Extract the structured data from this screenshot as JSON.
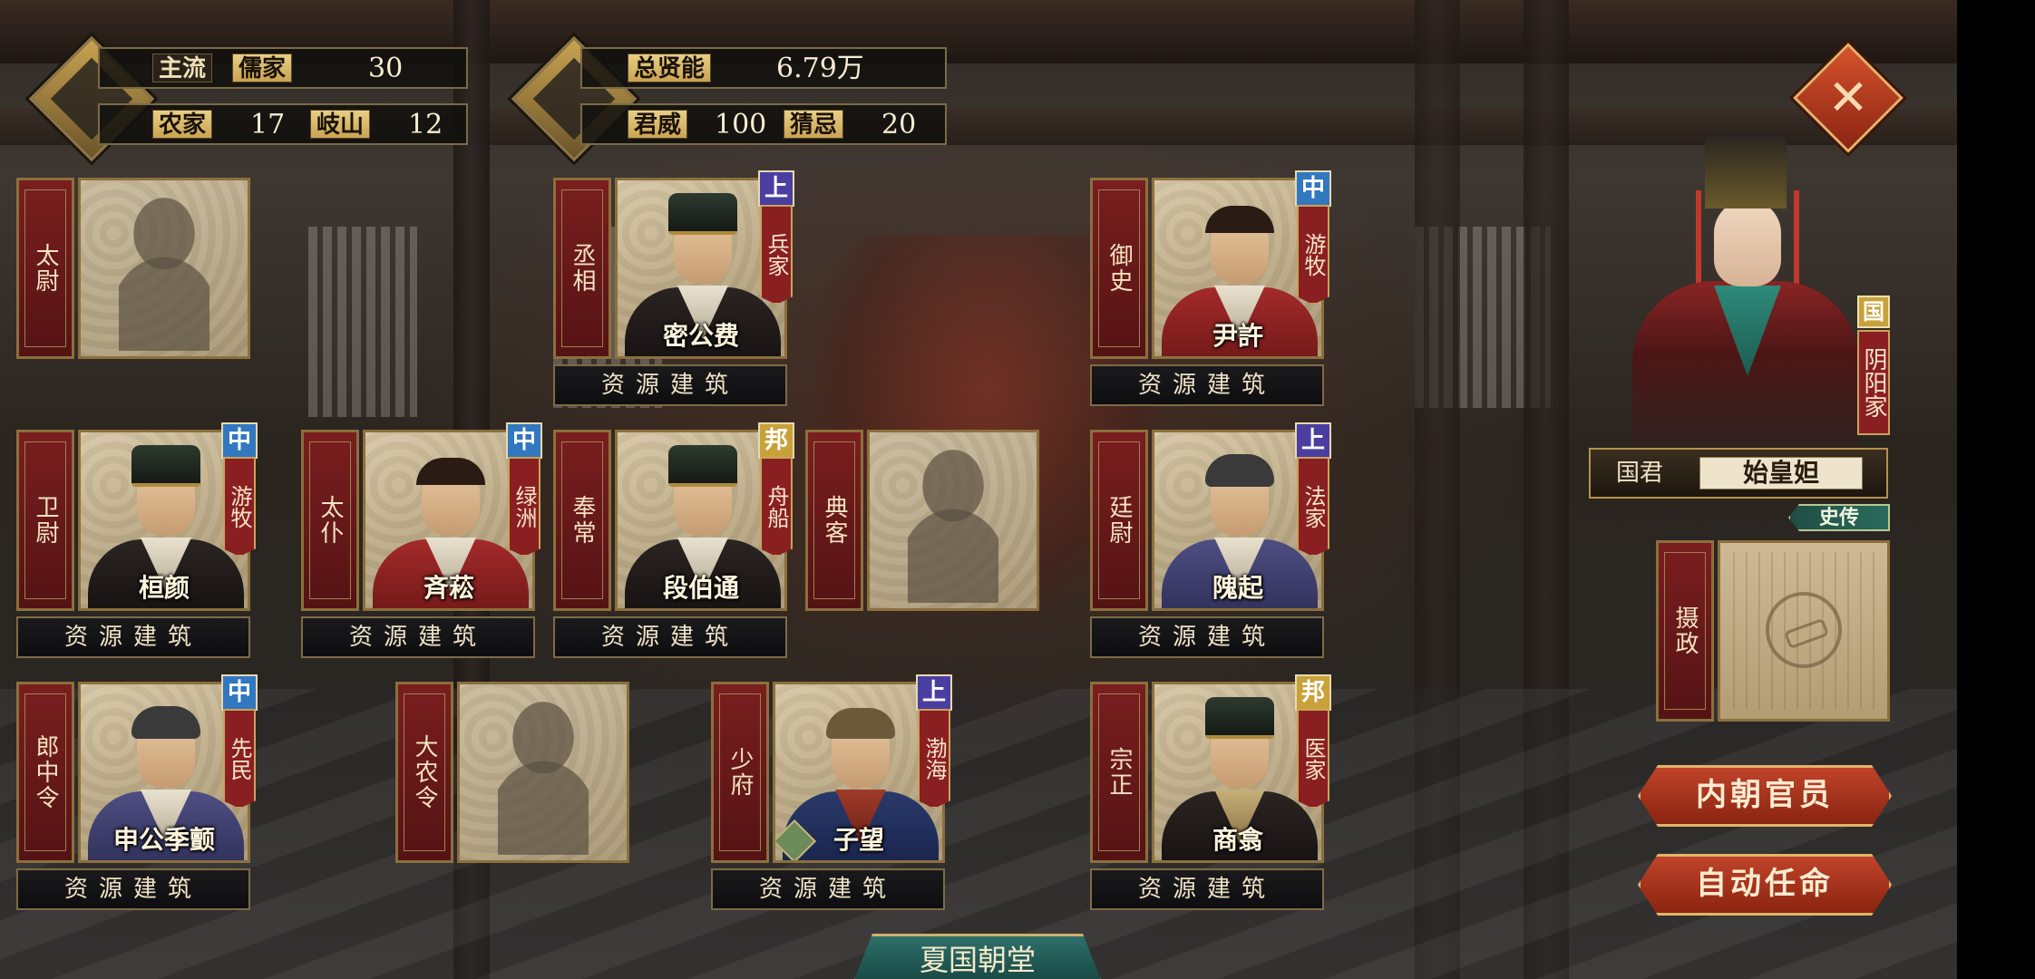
{
  "header": {
    "culture": {
      "mainstream_label": "主流",
      "mainstream_value": "儒家",
      "mainstream_count": "30",
      "school2_label": "农家",
      "school2_count": "17",
      "school3_label": "岐山",
      "school3_count": "12"
    },
    "talent": {
      "total_label": "总贤能",
      "total_value": "6.79万",
      "prestige_label": "君威",
      "prestige_value": "100",
      "suspicion_label": "猜忌",
      "suspicion_value": "20"
    }
  },
  "close_button": {
    "label": "✕"
  },
  "officials": [
    {
      "id": "taiwei",
      "title": "太尉",
      "name": "",
      "grade": "",
      "school": "",
      "filled": false,
      "button": "资源建筑"
    },
    {
      "id": "chengxiang",
      "title": "丞相",
      "name": "密公费",
      "grade": "上",
      "school": "兵家",
      "filled": true,
      "button": "资源建筑"
    },
    {
      "id": "yushi",
      "title": "御史",
      "name": "尹許",
      "grade": "中",
      "school": "游牧",
      "filled": true,
      "button": "资源建筑"
    },
    {
      "id": "weiwei",
      "title": "卫尉",
      "name": "桓颜",
      "grade": "中",
      "school": "游牧",
      "filled": true,
      "button": "资源建筑"
    },
    {
      "id": "taipu",
      "title": "太仆",
      "name": "斉菘",
      "grade": "中",
      "school": "绿洲",
      "filled": true,
      "button": "资源建筑"
    },
    {
      "id": "fengchang",
      "title": "奉常",
      "name": "段伯通",
      "grade": "邦",
      "school": "舟船",
      "filled": true,
      "button": "资源建筑"
    },
    {
      "id": "dianke",
      "title": "典客",
      "name": "",
      "grade": "",
      "school": "",
      "filled": false,
      "button": ""
    },
    {
      "id": "tingwei",
      "title": "廷尉",
      "name": "隗起",
      "grade": "上",
      "school": "法家",
      "filled": true,
      "button": "资源建筑"
    },
    {
      "id": "langzhongling",
      "title": "郎中令",
      "name": "申公季颤",
      "grade": "中",
      "school": "先民",
      "filled": true,
      "button": "资源建筑"
    },
    {
      "id": "danongling",
      "title": "大农令",
      "name": "",
      "grade": "",
      "school": "",
      "filled": false,
      "button": ""
    },
    {
      "id": "shaofu",
      "title": "少府",
      "name": "子望",
      "grade": "上",
      "school": "渤海",
      "filled": true,
      "button": "资源建筑"
    },
    {
      "id": "zongzheng",
      "title": "宗正",
      "name": "商翕",
      "grade": "邦",
      "school": "医家",
      "filled": true,
      "button": "资源建筑"
    }
  ],
  "consort": {
    "grade": "国",
    "school": "阴阳家",
    "ruler_label": "国君",
    "ruler_name": "始皇妲",
    "biography_button": "史传"
  },
  "regent": {
    "title": "摄政"
  },
  "actions": {
    "inner_court": "内朝官员",
    "auto_appoint": "自动任命"
  },
  "court_title": "夏国朝堂",
  "colors": {
    "grade_shang": "#4a3fa0",
    "grade_zhong": "#3178c0",
    "grade_bang": "#c9a13a",
    "banner_red": "#7a1e1e",
    "gold_border": "#8c6f3c"
  },
  "icons": {
    "culture_emblem": "bamboo-scroll-icon",
    "talent_emblem": "bronze-vessel-icon",
    "regent_seal": "seal-icon"
  }
}
